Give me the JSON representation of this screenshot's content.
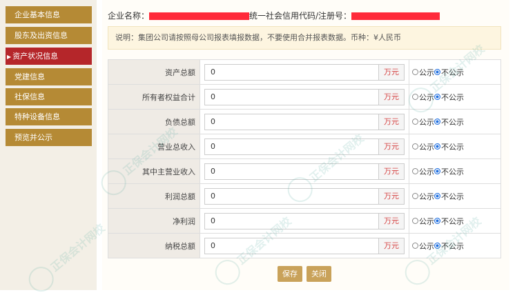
{
  "sidebar": {
    "items": [
      {
        "label": "企业基本信息"
      },
      {
        "label": "股东及出资信息"
      },
      {
        "label": "资产状况信息",
        "active_marker": "▶"
      },
      {
        "label": "党建信息"
      },
      {
        "label": "社保信息"
      },
      {
        "label": "特种设备信息"
      },
      {
        "label": "预览并公示"
      }
    ]
  },
  "header": {
    "company_label": "企业名称：",
    "credit_label": "统一社会信用代码/注册号："
  },
  "notice": "说明：集团公司请按照母公司报表填报数据，不要使用合并报表数据。币种：¥人民币",
  "fields": [
    {
      "label": "资产总额",
      "value": "0",
      "unit": "万元",
      "public_label": "公示",
      "private_label": "不公示",
      "selected": "不公示"
    },
    {
      "label": "所有者权益合计",
      "value": "0",
      "unit": "万元",
      "public_label": "公示",
      "private_label": "不公示",
      "selected": "不公示"
    },
    {
      "label": "负债总额",
      "value": "0",
      "unit": "万元",
      "public_label": "公示",
      "private_label": "不公示",
      "selected": "不公示"
    },
    {
      "label": "营业总收入",
      "value": "0",
      "unit": "万元",
      "public_label": "公示",
      "private_label": "不公示",
      "selected": "不公示"
    },
    {
      "label": "其中主营业收入",
      "value": "0",
      "unit": "万元",
      "public_label": "公示",
      "private_label": "不公示",
      "selected": "不公示"
    },
    {
      "label": "利润总额",
      "value": "0",
      "unit": "万元",
      "public_label": "公示",
      "private_label": "不公示",
      "selected": "不公示"
    },
    {
      "label": "净利润",
      "value": "0",
      "unit": "万元",
      "public_label": "公示",
      "private_label": "不公示",
      "selected": "不公示"
    },
    {
      "label": "纳税总额",
      "value": "0",
      "unit": "万元",
      "public_label": "公示",
      "private_label": "不公示",
      "selected": "不公示"
    }
  ],
  "buttons": {
    "save": "保存",
    "close": "关闭"
  },
  "watermark": {
    "text": "正保会计网校",
    "color": "#5aaaa0"
  },
  "colors": {
    "nav": "#b58a35",
    "nav_active": "#b5262a",
    "button": "#c9a25a",
    "redaction": "#ff2a3a",
    "unit_text": "#d64545"
  }
}
